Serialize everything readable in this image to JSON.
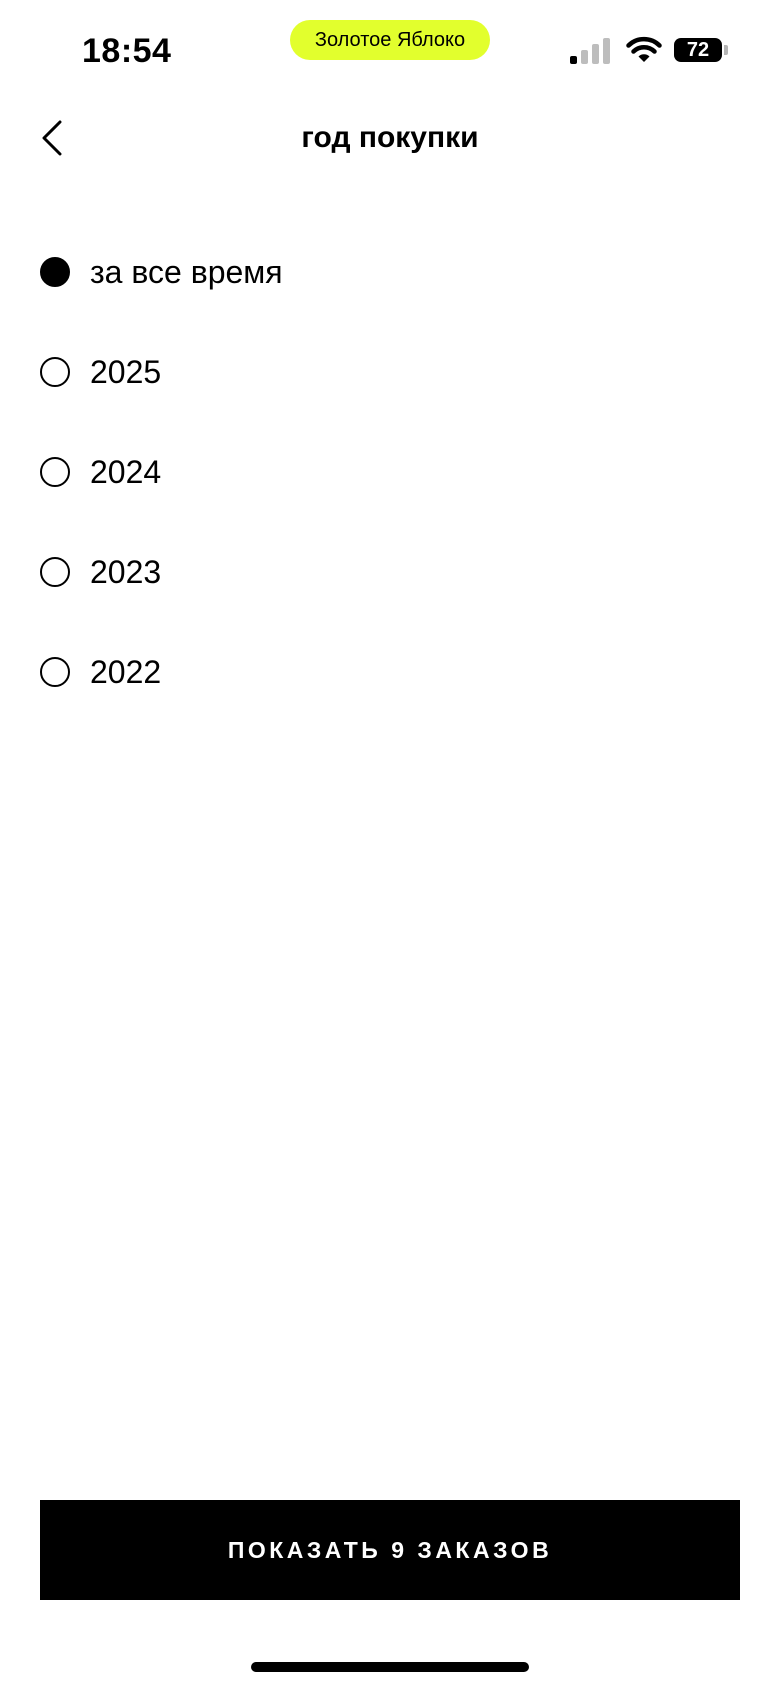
{
  "status_bar": {
    "time": "18:54",
    "pill_label": "Золотое Яблоко",
    "pill_color": "#e2ff2d",
    "signal_icon": "cellular-signal-icon",
    "wifi_icon": "wifi-icon",
    "battery_level": "72"
  },
  "header": {
    "back_icon": "chevron-left-icon",
    "title": "год покупки"
  },
  "options": [
    {
      "label": "за все время",
      "selected": true
    },
    {
      "label": "2025",
      "selected": false
    },
    {
      "label": "2024",
      "selected": false
    },
    {
      "label": "2023",
      "selected": false
    },
    {
      "label": "2022",
      "selected": false
    }
  ],
  "footer": {
    "cta_label": "ПОКАЗАТЬ 9 ЗАКАЗОВ"
  }
}
